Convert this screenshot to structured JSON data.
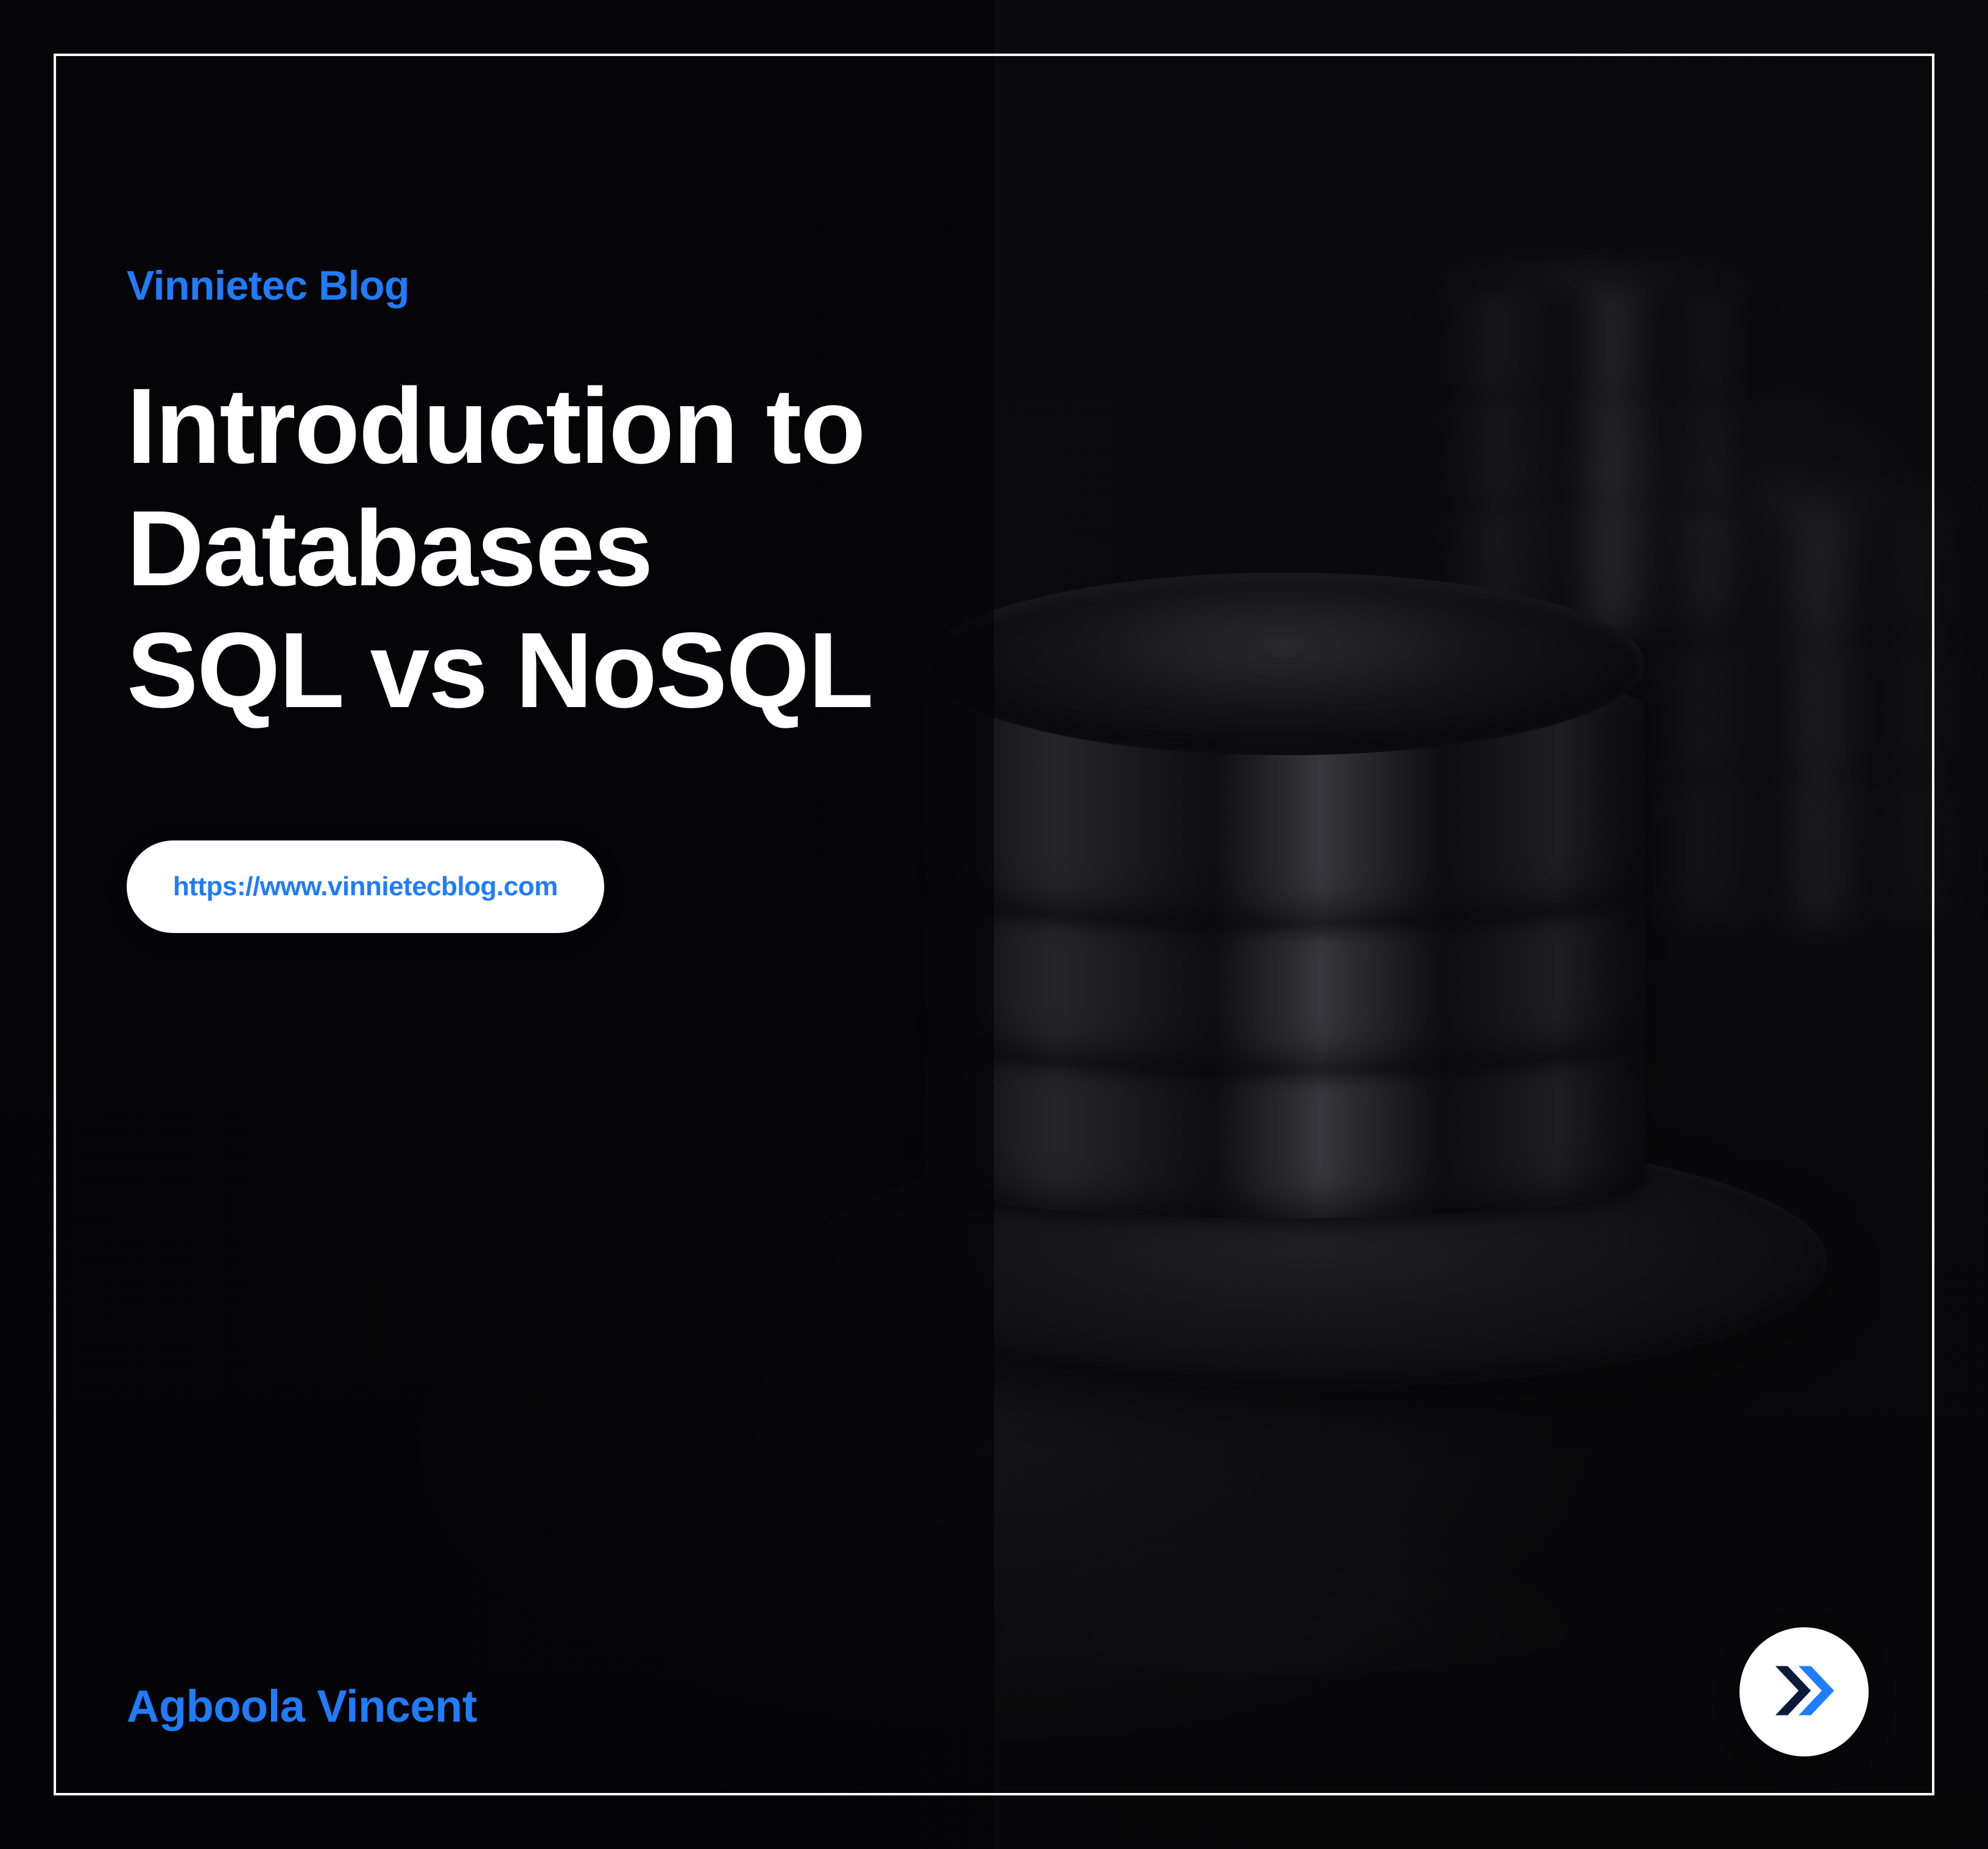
{
  "brand": "Vinnietec Blog",
  "title_line1": "Introduction to",
  "title_line2": "Databases",
  "title_line3": "SQL vs NoSQL",
  "url_label": "https://www.vinnietecblog.com",
  "author": "Agboola Vincent",
  "colors": {
    "accent": "#1f7cff",
    "bg": "#05060a",
    "text": "#ffffff"
  },
  "icons": {
    "next": "double-chevron-right-icon"
  }
}
